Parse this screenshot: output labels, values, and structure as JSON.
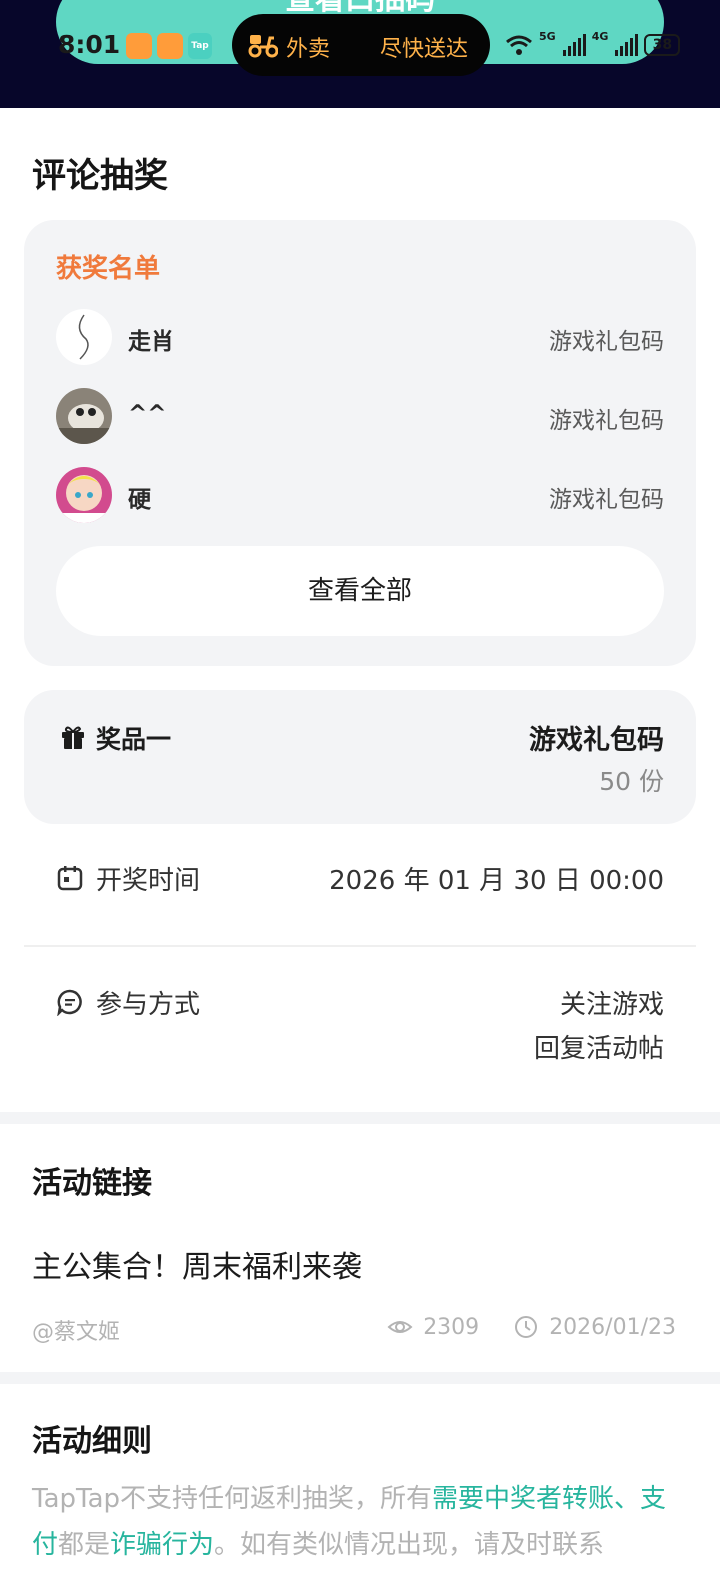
{
  "status_bar": {
    "time": "8:01",
    "banner_text": "查看口抽码",
    "island_left": "外卖",
    "island_right": "尽快送达",
    "app_tap": "Tap",
    "net1": "5G",
    "net2": "4G",
    "battery": "38"
  },
  "section_title": "评论抽奖",
  "winners": {
    "title": "获奖名单",
    "rows": [
      {
        "name": "走肖",
        "prize": "游戏礼包码"
      },
      {
        "name": "^^",
        "prize": "游戏礼包码"
      },
      {
        "name": "硬",
        "prize": "游戏礼包码"
      }
    ],
    "view_all": "查看全部"
  },
  "prize": {
    "label": "奖品一",
    "name": "游戏礼包码",
    "quantity": "50 份"
  },
  "draw_time": {
    "label": "开奖时间",
    "value": "2026 年 01 月 30 日 00:00"
  },
  "participation": {
    "label": "参与方式",
    "line1": "关注游戏",
    "line2": "回复活动帖"
  },
  "activity_link": {
    "title": "活动链接",
    "post_title": "主公集合！周末福利来袭",
    "author": "@蔡文姬",
    "views": "2309",
    "date": "2026/01/23"
  },
  "rules": {
    "title": "活动细则",
    "part1": "TapTap不支持任何返利抽奖，所有",
    "hl1": "需要中奖者转账、支付",
    "part2": "都是",
    "hl2": "诈骗行为",
    "part3": "。如有类似情况出现，请及时联系"
  },
  "colors": {
    "accent_teal": "#27b59e",
    "accent_orange": "#f07a3c",
    "card_bg": "#f3f4f6"
  }
}
